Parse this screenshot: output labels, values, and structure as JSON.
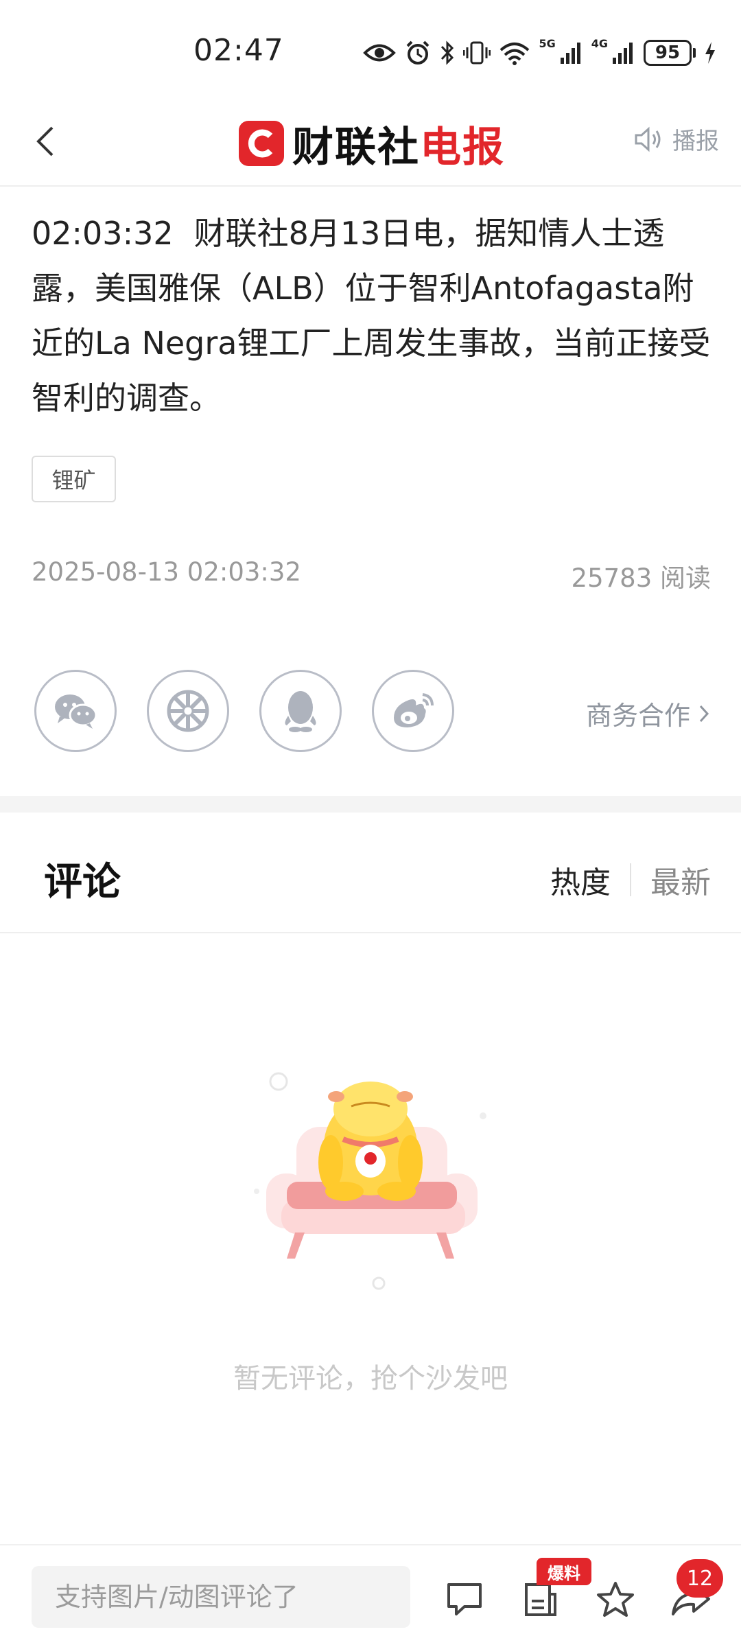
{
  "status_bar": {
    "time": "02:47",
    "net_5g": "5G",
    "net_4g": "4G",
    "battery": "95"
  },
  "header": {
    "logo_main": "财联社",
    "logo_accent": "电报",
    "broadcast_label": "播报"
  },
  "article": {
    "time": "02:03:32",
    "body": "财联社8月13日电，据知情人士透露，美国雅保（ALB）位于智利Antofagasta附近的La Negra锂工厂上周发生事故，当前正接受智利的调查。",
    "tag": "锂矿",
    "date": "2025-08-13 02:03:32",
    "reads": "25783 阅读"
  },
  "share": {
    "business_label": "商务合作"
  },
  "comments": {
    "title": "评论",
    "sort_hot": "热度",
    "sort_new": "最新",
    "empty_text": "暂无评论，抢个沙发吧"
  },
  "bottom_bar": {
    "input_placeholder": "支持图片/动图评论了",
    "baoliao_badge": "爆料",
    "share_count": "12"
  },
  "colors": {
    "brand_red": "#e2262b",
    "muted_gray": "#999999"
  }
}
